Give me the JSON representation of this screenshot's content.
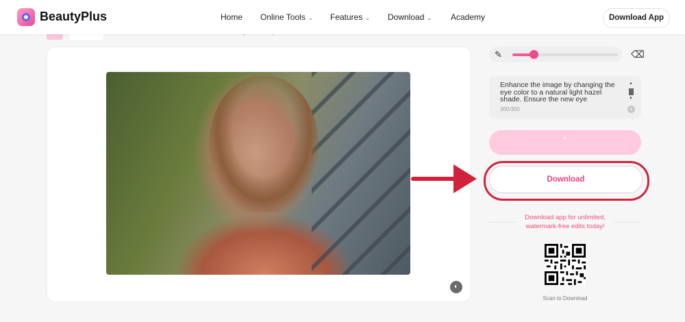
{
  "header": {
    "brand": "BeautyPlus",
    "nav": [
      {
        "label": "Home",
        "has_dropdown": false
      },
      {
        "label": "Online Tools",
        "has_dropdown": true
      },
      {
        "label": "Features",
        "has_dropdown": true
      },
      {
        "label": "Download",
        "has_dropdown": true
      },
      {
        "label": "Academy",
        "has_dropdown": false
      }
    ],
    "download_app_label": "Download App"
  },
  "editor": {
    "brush_size_level": 0.2,
    "prompt_text": "Enhance the image by changing the eye color to a natural light hazel shade. Ensure the new eye",
    "char_counter": "300/300",
    "download_label": "Download",
    "promo_line1": "Download app for unlimited,",
    "promo_line2": "watermark-free edits today!",
    "scan_label": "Scan to Download"
  },
  "icons": {
    "brush": "brush-icon",
    "eraser": "eraser-icon",
    "clear": "clear-icon",
    "compare": "compare-icon",
    "qr": "qr-code"
  },
  "colors": {
    "accent": "#f04a8e",
    "highlight": "#d3213b",
    "generate_disabled": "#ffc9de"
  }
}
